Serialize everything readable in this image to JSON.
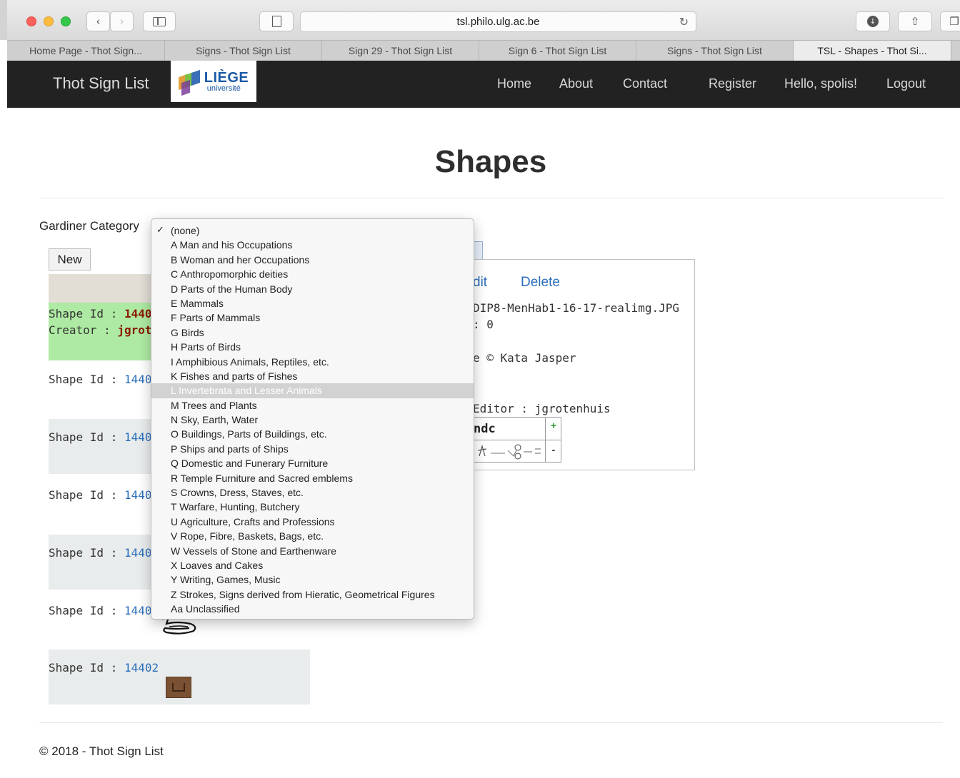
{
  "browser": {
    "url": "tsl.philo.ulg.ac.be",
    "tabs": [
      {
        "label": "Home Page - Thot Sign..."
      },
      {
        "label": "Signs - Thot Sign List"
      },
      {
        "label": "Sign 29 - Thot Sign List"
      },
      {
        "label": "Sign 6 - Thot Sign List"
      },
      {
        "label": "Signs - Thot Sign List"
      },
      {
        "label": "TSL - Shapes - Thot Si..."
      }
    ]
  },
  "navbar": {
    "brand": "Thot Sign List",
    "logo_main": "LIÈGE",
    "logo_sub": "université",
    "links": [
      "Home",
      "About",
      "Contact",
      "Register",
      "Hello, spolis!",
      "Logout"
    ]
  },
  "page": {
    "title": "Shapes",
    "filter_label": "Gardiner Category",
    "new_button": "New",
    "selected": {
      "id_label": "Shape Id :",
      "id": "14408",
      "creator_label": "Creator :",
      "creator": "jgrotenl"
    },
    "rows": [
      {
        "label": "Shape Id :",
        "id": "14407"
      },
      {
        "label": "Shape Id :",
        "id": "14406"
      },
      {
        "label": "Shape Id :",
        "id": "14405"
      },
      {
        "label": "Shape Id :",
        "id": "14404"
      },
      {
        "label": "Shape Id :",
        "id": "14403"
      },
      {
        "label": "Shape Id :",
        "id": "14402"
      }
    ]
  },
  "detail": {
    "edit": "dit",
    "delete": "Delete",
    "filename": "DIP8-MenHab1-16-17-realimg.JPG",
    "value_line": ": 0",
    "copyright": "e © Kata Jasper",
    "editor": "Editor : jgrotenhuis",
    "table_header": "ndc",
    "add": "+",
    "remove": "-"
  },
  "dropdown": {
    "checkmark": "✓",
    "highlighted_index": 12,
    "options": [
      "(none)",
      "A Man and his Occupations",
      "B Woman and her Occupations",
      "C Anthropomorphic deities",
      "D Parts of the Human Body",
      "E Mammals",
      "F Parts of Mammals",
      "G Birds",
      "H Parts of Birds",
      "I Amphibious Animals, Reptiles, etc.",
      "K Fishes and parts of Fishes",
      "L Invertebrata and Lesser Animals",
      "M Trees and Plants",
      "N Sky, Earth, Water",
      "O Buildings, Parts of Buildings, etc.",
      "P Ships and parts of Ships",
      "Q Domestic and Funerary Furniture",
      "R Temple Furniture and Sacred emblems",
      "S Crowns, Dress, Staves, etc.",
      "T Warfare, Hunting, Butchery",
      "U Agriculture, Crafts and Professions",
      "V Rope, Fibre, Baskets, Bags, etc.",
      "W Vessels of Stone and Earthenware",
      "X Loaves and Cakes",
      "Y Writing, Games, Music",
      "Z Strokes, Signs derived from Hieratic, Geometrical Figures",
      "Aa Unclassified"
    ]
  },
  "footer": "© 2018 - Thot Sign List"
}
